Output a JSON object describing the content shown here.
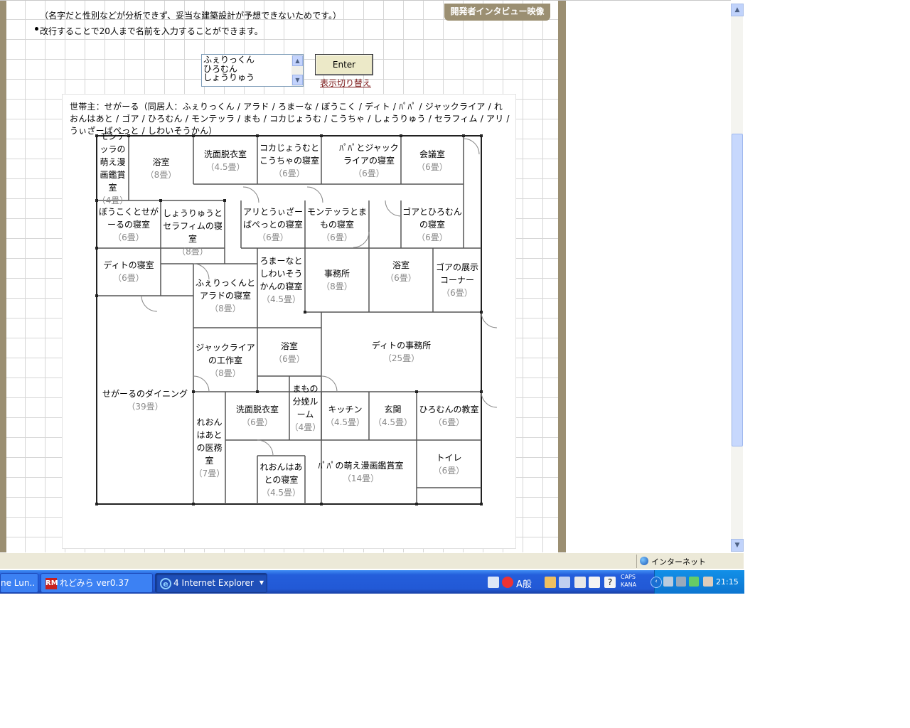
{
  "page": {
    "notes": [
      "（名字だと性別などが分析できず、妥当な建築設計が予想できないためです。）",
      "改行することで20人まで名前を入力することができます。"
    ],
    "interview_tab": "開発者インタビュー映像",
    "names_input": "ふぇりっくん\nひろむん\nしょうりゅう",
    "enter_label": "Enter",
    "toggle_link": "表示切り替え",
    "residents": "世帯主：せがーる（同居人：ふぇりっくん / アラド / ろまーな / ぼうこく / ディト / ﾊﾟﾊﾟ / ジャックライア / れおんはあと / ゴア / ひろむん / モンテッラ / まも / コカじょうむ / こうちゃ / しょうりゅう / セラフィム / アリ / うぃざーばぺっと / しわいそうかん）"
  },
  "floorplan": {
    "rooms": [
      {
        "name": "モンテッラの萌え漫画鑑賞室",
        "size": "（4畳）"
      },
      {
        "name": "浴室",
        "size": "（8畳）"
      },
      {
        "name": "洗面脱衣室",
        "size": "（4.5畳）"
      },
      {
        "name": "コカじょうむとこうちゃの寝室",
        "size": "（6畳）"
      },
      {
        "name": "ﾊﾟﾊﾟとジャックライアの寝室",
        "size": "（6畳）"
      },
      {
        "name": "会議室",
        "size": "（6畳）"
      },
      {
        "name": "ぼうこくとせがーるの寝室",
        "size": "（6畳）"
      },
      {
        "name": "しょうりゅうとセラフィムの寝室",
        "size": "（8畳）"
      },
      {
        "name": "アリとうぃざーばぺっとの寝室",
        "size": "（6畳）"
      },
      {
        "name": "モンテッラとまもの寝室",
        "size": "（6畳）"
      },
      {
        "name": "ゴアとひろむんの寝室",
        "size": "（6畳）"
      },
      {
        "name": "ディトの寝室",
        "size": "（6畳）"
      },
      {
        "name": "ろまーなとしわいそうかんの寝室",
        "size": "（4.5畳）"
      },
      {
        "name": "事務所",
        "size": "（8畳）"
      },
      {
        "name": "浴室",
        "size": "（6畳）"
      },
      {
        "name": "ゴアの展示コーナー",
        "size": "（6畳）"
      },
      {
        "name": "ふぇりっくんとアラドの寝室",
        "size": "（8畳）"
      },
      {
        "name": "ジャックライアの工作室",
        "size": "（8畳）"
      },
      {
        "name": "浴室",
        "size": "（6畳）"
      },
      {
        "name": "ディトの事務所",
        "size": "（25畳）"
      },
      {
        "name": "せがーるのダイニング",
        "size": "（39畳）"
      },
      {
        "name": "洗面脱衣室",
        "size": "（6畳）"
      },
      {
        "name": "まもの分娩ルーム",
        "size": "（4畳）"
      },
      {
        "name": "キッチン",
        "size": "（4.5畳）"
      },
      {
        "name": "玄関",
        "size": "（4.5畳）"
      },
      {
        "name": "ひろむんの教室",
        "size": "（6畳）"
      },
      {
        "name": "れおんはあとの医務室",
        "size": "（7畳）"
      },
      {
        "name": "トイレ",
        "size": "（6畳）"
      },
      {
        "name": "れおんはあとの寝室",
        "size": "（4.5畳）"
      },
      {
        "name": "ﾊﾟﾊﾟの萌え漫画鑑賞室",
        "size": "（14畳）"
      }
    ]
  },
  "browser": {
    "status_zone": "インターネット"
  },
  "taskbar": {
    "buttons": [
      {
        "label": "ne Lun.."
      },
      {
        "label": "れどみら ver0.37",
        "icon": "RM"
      },
      {
        "label": "4 Internet Explorer"
      }
    ],
    "ime_text": "A般",
    "caps": "CAPS",
    "kana": "KANA",
    "clock": "21:15"
  },
  "colors": {
    "frame": "#9b8f72",
    "link": "#7d1a1a",
    "taskbar": "#245edb"
  }
}
